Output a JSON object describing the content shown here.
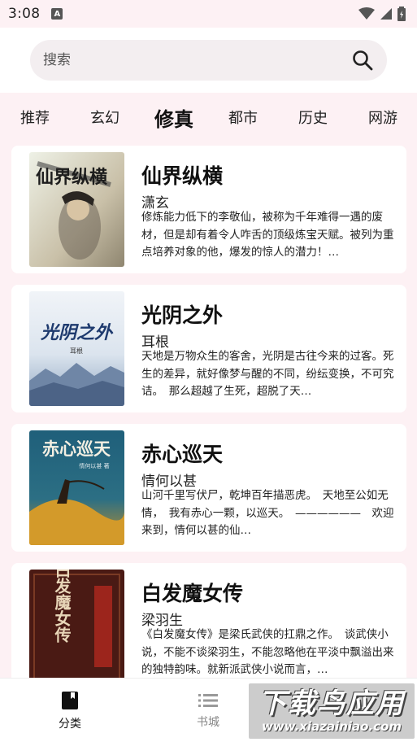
{
  "status_bar": {
    "time": "3:08",
    "notification_letter": "A"
  },
  "search": {
    "placeholder": "搜索"
  },
  "tabs": [
    {
      "label": "推荐"
    },
    {
      "label": "玄幻"
    },
    {
      "label": "修真"
    },
    {
      "label": "都市"
    },
    {
      "label": "历史"
    },
    {
      "label": "网游"
    }
  ],
  "active_tab": "修真",
  "books": [
    {
      "title": "仙界纵横",
      "author": "潇玄",
      "description": "修炼能力低下的李敬仙，被称为千年难得一遇的废材，但是却有着令人咋舌的顶级炼宝天赋。被列为重点培养对象的他，爆发的惊人的潜力！…",
      "cover_text": "仙界纵横"
    },
    {
      "title": "光阴之外",
      "author": "耳根",
      "description": "天地是万物众生的客舍，光阴是古往今来的过客。死生的差异，就好像梦与醒的不同，纷纭变换，不可究诘。　那么超越了生死，超脱了天…",
      "cover_text": "光阴之外",
      "cover_author": "耳根"
    },
    {
      "title": "赤心巡天",
      "author": "情何以甚",
      "description": "山河千里写伏尸，乾坤百年描恶虎。　天地至公如无情，　我有赤心一颗，以巡天。　——————　欢迎来到，情何以甚的仙…",
      "cover_text": "赤心巡天",
      "cover_author": "情何以甚 著"
    },
    {
      "title": "白发魔女传",
      "author": "梁羽生",
      "description": "《白发魔女传》是梁氏武侠的扛鼎之作。　谈武侠小说，不能不谈梁羽生，不能忽略他在平淡中飘溢出来的独特韵味。就新派武侠小说而言，…",
      "cover_text": "白发魔女传"
    }
  ],
  "bottom_nav": [
    {
      "label": "分类",
      "icon": "book-icon",
      "active": true
    },
    {
      "label": "书城",
      "icon": "list-icon",
      "active": false
    }
  ],
  "watermark": {
    "main": "下载鸟应用",
    "sub": "www.xiazainiao.com"
  },
  "colors": {
    "page_bg": "#fdf1f4",
    "card_bg": "#ffffff",
    "search_bg": "#f3eef0"
  }
}
